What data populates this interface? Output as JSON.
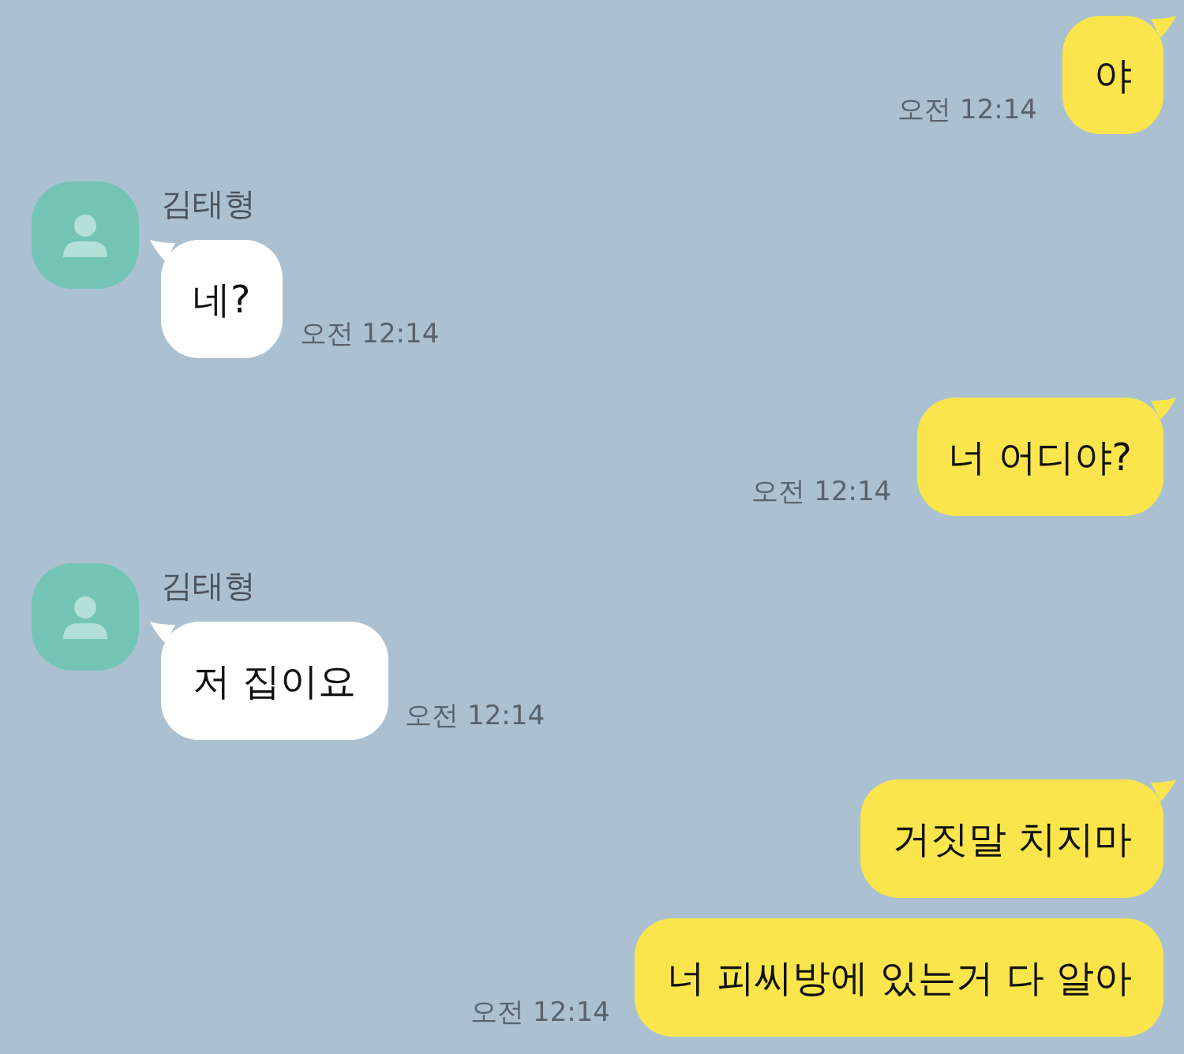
{
  "messages": [
    {
      "kind": "sent",
      "text": "야",
      "time": "오전 12:14",
      "tail": true
    },
    {
      "kind": "received",
      "sender": "김태형",
      "text": "네?",
      "time": "오전 12:14",
      "tail": true
    },
    {
      "kind": "sent",
      "text": "너 어디야?",
      "time": "오전 12:14",
      "tail": true
    },
    {
      "kind": "received",
      "sender": "김태형",
      "text": "저 집이요",
      "time": "오전 12:14",
      "tail": true
    },
    {
      "kind": "sent",
      "text": "거짓말 치지마",
      "tail": true
    },
    {
      "kind": "sent",
      "text": "너 피씨방에 있는거 다 알아",
      "time": "오전 12:14",
      "tail": false
    }
  ]
}
